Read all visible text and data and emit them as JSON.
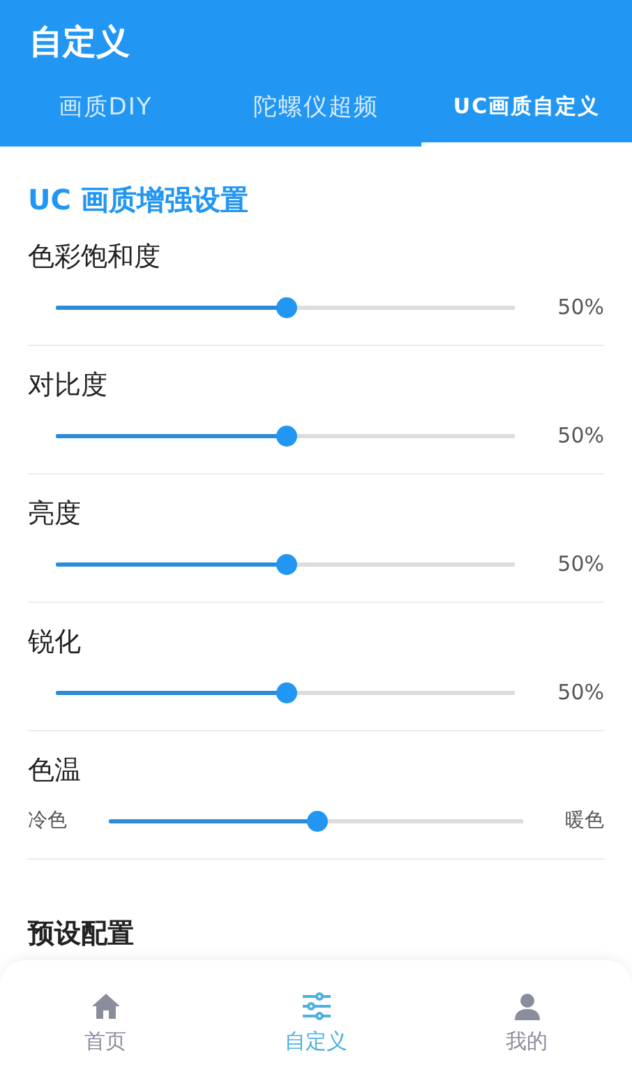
{
  "header": {
    "title": "自定义"
  },
  "tabs": [
    {
      "label": "画质DIY",
      "selected": false
    },
    {
      "label": "陀螺仪超频",
      "selected": false
    },
    {
      "label": "UC画质自定义",
      "selected": true
    }
  ],
  "section": {
    "title": "UC 画质增强设置"
  },
  "sliders": [
    {
      "kind": "percent",
      "label": "色彩饱和度",
      "level": 0.5,
      "reading": "50%"
    },
    {
      "kind": "percent",
      "label": "对比度",
      "level": 0.5,
      "reading": "50%"
    },
    {
      "kind": "percent",
      "label": "亮度",
      "level": 0.5,
      "reading": "50%"
    },
    {
      "kind": "percent",
      "label": "锐化",
      "level": 0.5,
      "reading": "50%"
    },
    {
      "kind": "range",
      "label": "色温",
      "level": 0.5,
      "min_label": "冷色",
      "max_label": "暖色"
    }
  ],
  "preset": {
    "title": "预设配置"
  },
  "nav": [
    {
      "kind": "home",
      "label": "首页",
      "selected": false
    },
    {
      "kind": "sliders",
      "label": "自定义",
      "selected": true
    },
    {
      "kind": "person",
      "label": "我的",
      "selected": false
    }
  ]
}
